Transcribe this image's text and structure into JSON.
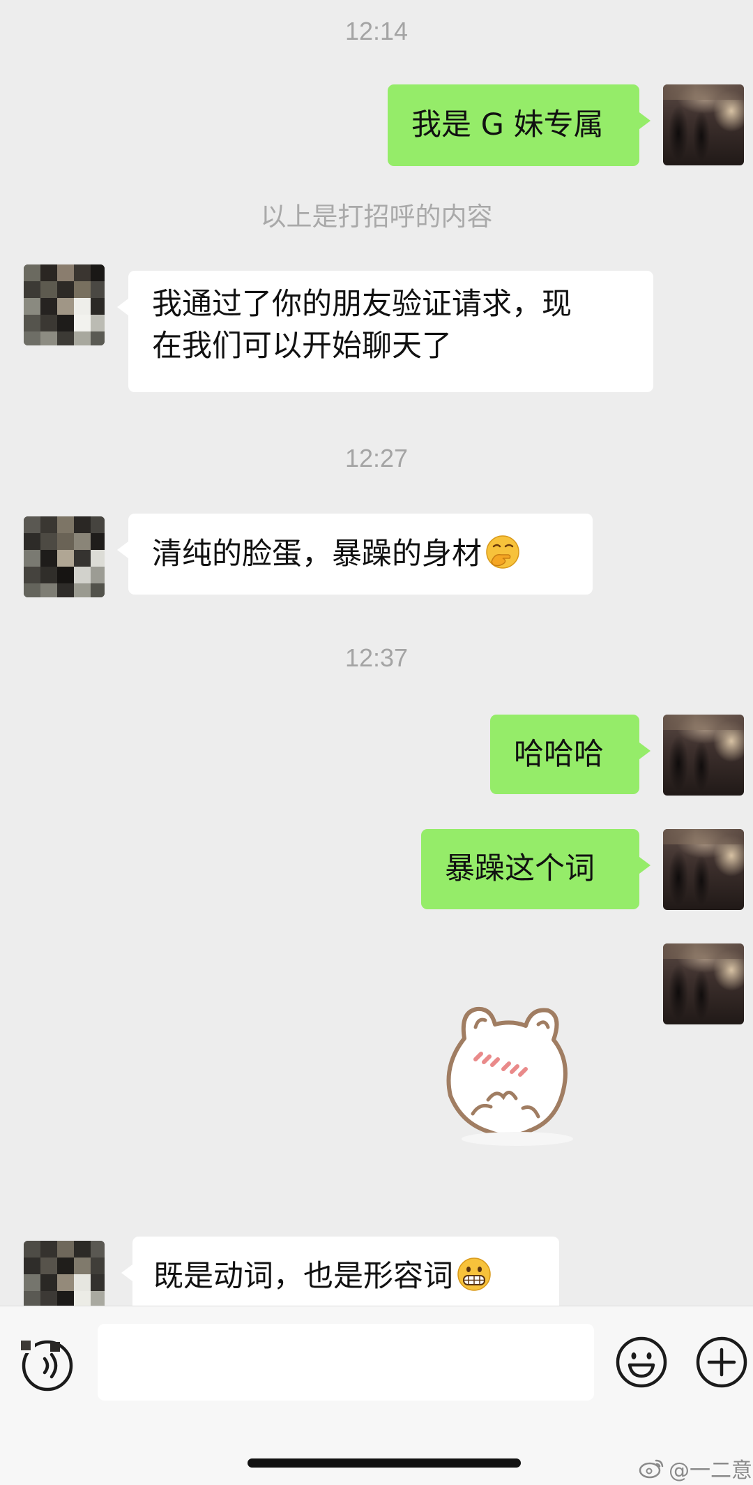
{
  "chat": {
    "times": [
      "12:14",
      "12:27",
      "12:37"
    ],
    "system_note": "以上是打招呼的内容",
    "messages": [
      {
        "from": "me",
        "text": "我是 G 妹专属"
      },
      {
        "from": "them",
        "line1": "我通过了你的朋友验证请求，现",
        "line2": "在我们可以开始聊天了"
      },
      {
        "from": "them",
        "text": "清纯的脸蛋，暴躁的身材",
        "emoji": "face-with-hand-over-mouth"
      },
      {
        "from": "me",
        "text": "哈哈哈"
      },
      {
        "from": "me",
        "text": "暴躁这个词"
      },
      {
        "from": "me",
        "sticker": "blushing-bear-sticker"
      },
      {
        "from": "them",
        "text": "既是动词，也是形容词",
        "emoji": "grimacing-face"
      }
    ]
  },
  "input_bar": {
    "placeholder": "",
    "voice_icon": "voice-icon",
    "emoji_icon": "smiley-icon",
    "plus_icon": "plus-icon"
  },
  "watermark": {
    "text": "@一二意",
    "icon": "weibo-icon"
  },
  "colors": {
    "background": "#ededed",
    "my_bubble": "#95ec69",
    "their_bubble": "#ffffff",
    "timestamp": "#a4a4a4"
  }
}
